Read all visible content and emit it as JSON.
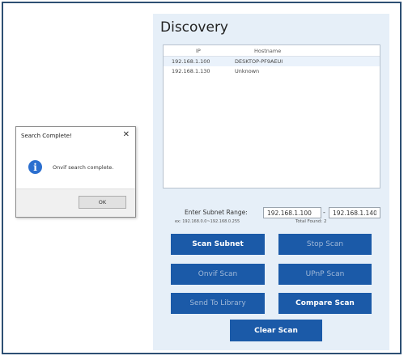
{
  "app": {
    "title": "Discovery"
  },
  "results": {
    "headers": {
      "ip": "IP",
      "hostname": "Hostname"
    },
    "rows": [
      {
        "ip": "192.168.1.100",
        "hostname": "DESKTOP-PF9AEUI"
      },
      {
        "ip": "192.168.1.130",
        "hostname": "Unknown"
      }
    ]
  },
  "subnet": {
    "label": "Enter Subnet Range:",
    "example": "ex: 192.168.0.0~192.168.0.255",
    "from_value": "192.168.1.100",
    "separator": "-",
    "to_value": "192.168.1.140",
    "total_found": "Total Found: 2"
  },
  "buttons": {
    "scan_subnet": "Scan Subnet",
    "stop_scan": "Stop Scan",
    "onvif_scan": "Onvif Scan",
    "upnp_scan": "UPnP Scan",
    "send_to_library": "Send To Library",
    "compare_scan": "Compare Scan",
    "clear_scan": "Clear Scan"
  },
  "dialog": {
    "title": "Search Complete!",
    "close": "✕",
    "message": "Onvif search complete.",
    "ok": "OK",
    "icon": "info-icon"
  },
  "colors": {
    "button": "#1b5aa8",
    "panel": "#e6eff8",
    "frame": "#2d4f73"
  }
}
